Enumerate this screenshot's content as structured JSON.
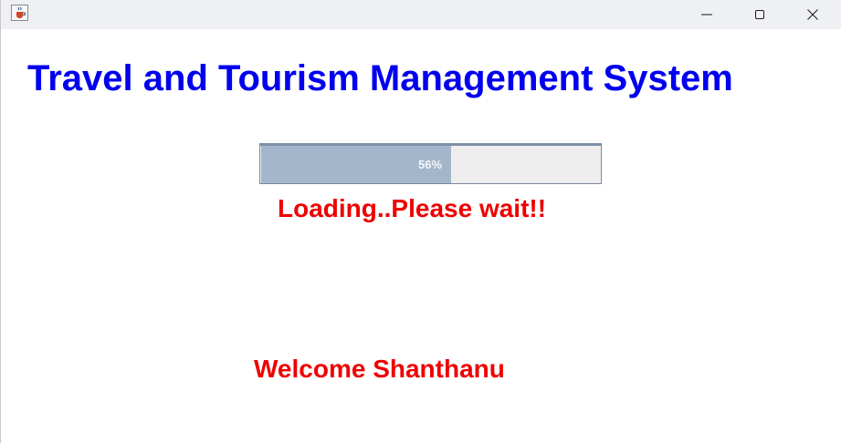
{
  "window": {
    "icon": "java-cup-icon",
    "controls": {
      "minimize_icon": "minimize-icon",
      "maximize_icon": "maximize-icon",
      "close_icon": "close-icon"
    }
  },
  "main": {
    "heading": "Travel and Tourism Management System",
    "progress": {
      "value_percent": 56,
      "text": "56%"
    },
    "loading_text": "Loading..Please wait!!",
    "welcome_text": "Welcome Shanthanu"
  },
  "colors": {
    "heading": "#0000ee",
    "status_text": "#ee0000",
    "progress_fill": "#a4b6cb",
    "progress_track": "#eeeeee"
  }
}
